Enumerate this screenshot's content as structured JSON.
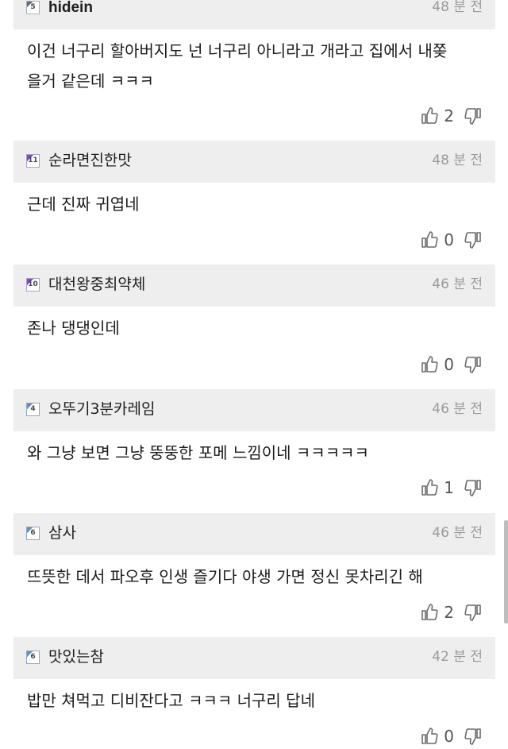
{
  "comments": [
    {
      "level": "5",
      "nickname": "hidein",
      "time": "48 분 전",
      "text_lines": [
        "이건 너구리 할아버지도 넌 너구리 아니라고 개라고 집에서 내쫒",
        "을거 같은데 ㅋㅋㅋ"
      ],
      "likes": "2"
    },
    {
      "level": "11",
      "nickname": "순라면진한맛",
      "time": "48 분 전",
      "text_lines": [
        "근데 진짜 귀엽네"
      ],
      "likes": "0"
    },
    {
      "level": "10",
      "nickname": "대천왕중최약체",
      "time": "46 분 전",
      "text_lines": [
        "존나 댕댕인데"
      ],
      "likes": "0"
    },
    {
      "level": "4",
      "nickname": "오뚜기3분카레임",
      "time": "46 분 전",
      "text_lines": [
        "와 그냥 보면 그냥 뚱뚱한 포메 느낌이네 ㅋㅋㅋㅋㅋ"
      ],
      "likes": "1"
    },
    {
      "level": "6",
      "nickname": "삼사",
      "time": "46 분 전",
      "text_lines": [
        "뜨뜻한 데서 파오후 인생 즐기다 야생 가면 정신 못차리긴 해"
      ],
      "likes": "2"
    },
    {
      "level": "6",
      "nickname": "맛있는참",
      "time": "42 분 전",
      "text_lines": [
        "밥만 쳐먹고 디비잔다고 ㅋㅋㅋ 너구리 답네"
      ],
      "likes": "0"
    }
  ],
  "icons": {
    "like": "thumbs-up-icon",
    "dislike": "thumbs-down-icon"
  },
  "colors": {
    "header_bg": "#eeeeee",
    "timestamp": "#9a9a9a",
    "badge_purple": "#7b4fc4",
    "badge_blue": "#6c8fc0"
  }
}
